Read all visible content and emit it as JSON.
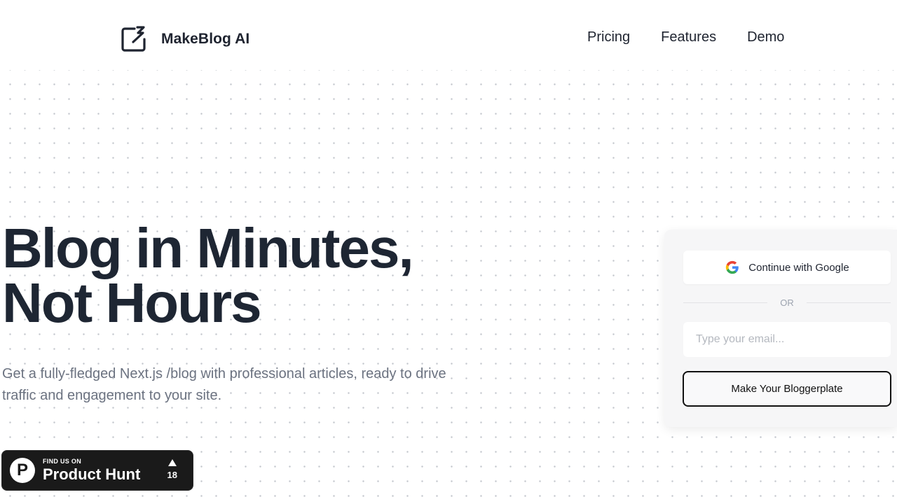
{
  "brand": {
    "name": "MakeBlog AI",
    "icon": "pencil-box-icon"
  },
  "nav": {
    "pricing": "Pricing",
    "features": "Features",
    "demo": "Demo"
  },
  "hero": {
    "title_line1": "Blog in Minutes,",
    "title_line2": "Not Hours",
    "subtitle": "Get a fully-fledged Next.js /blog with professional articles, ready to drive traffic and engagement to your site."
  },
  "product_hunt": {
    "small_label": "FIND US ON",
    "big_label": "Product Hunt",
    "letter": "P",
    "votes": "18",
    "icon": "product-hunt-icon"
  },
  "signup": {
    "google_label": "Continue with Google",
    "google_icon": "google-icon",
    "or_label": "OR",
    "email_placeholder": "Type your email...",
    "email_value": "",
    "cta_label": "Make Your Bloggerplate"
  },
  "colors": {
    "text": "#1f2430",
    "card_bg": "#f6f6f7",
    "badge_bg": "#1a1a1a",
    "dots": "#c4c8ce"
  }
}
